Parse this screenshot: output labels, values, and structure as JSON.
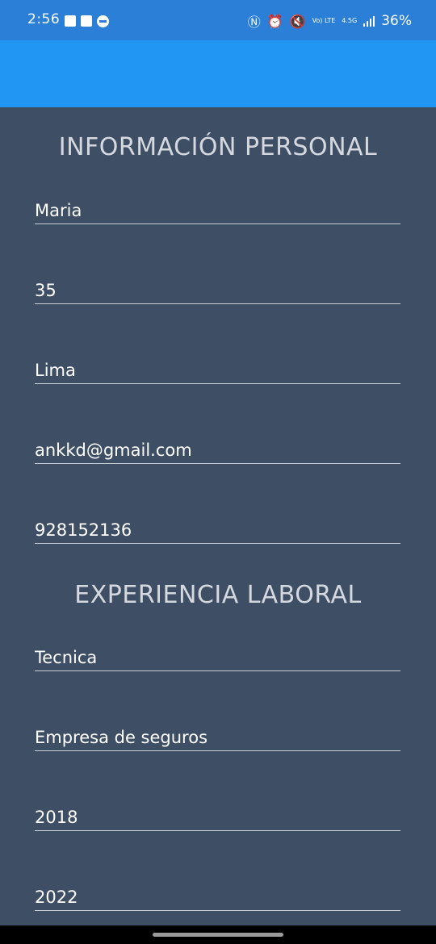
{
  "status_bar": {
    "time": "2:56",
    "volte": "Vo) LTE",
    "network": "4.5G",
    "battery": "36%"
  },
  "sections": {
    "personal_title": "INFORMACIÓN PERSONAL",
    "work_title": "EXPERIENCIA LABORAL"
  },
  "personal_fields": {
    "name": "Maria",
    "age": "35",
    "city": "Lima",
    "email": "ankkd@gmail.com",
    "phone": "928152136"
  },
  "work_fields": {
    "position": "Tecnica",
    "company": "Empresa de seguros",
    "start_year": "2018",
    "end_year": "2022"
  }
}
